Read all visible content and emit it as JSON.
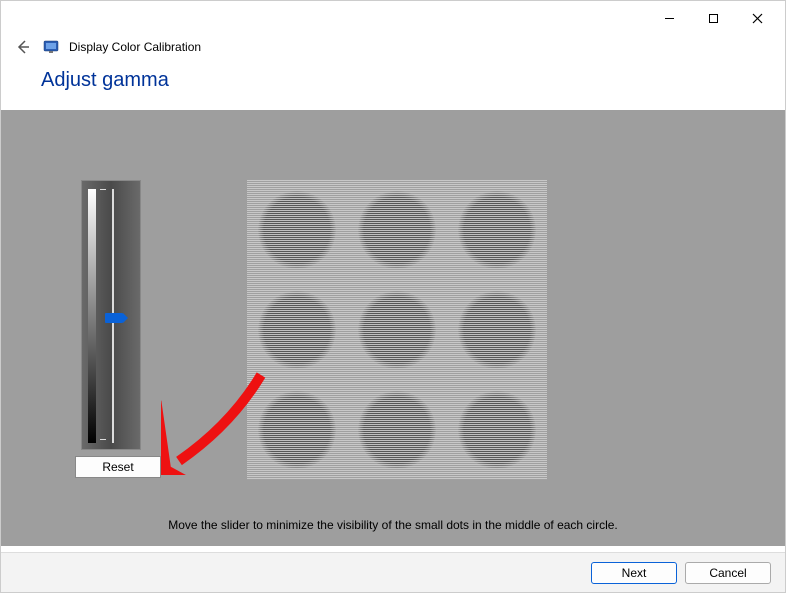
{
  "window": {
    "app_title": "Display Color Calibration"
  },
  "page": {
    "heading": "Adjust gamma",
    "instruction": "Move the slider to minimize the visibility of the small dots in the middle of each circle."
  },
  "controls": {
    "reset_label": "Reset",
    "next_label": "Next",
    "cancel_label": "Cancel"
  },
  "slider": {
    "value_percent": 50
  },
  "icons": {
    "back": "back-arrow",
    "minimize": "minimize",
    "maximize": "maximize",
    "close": "close"
  }
}
